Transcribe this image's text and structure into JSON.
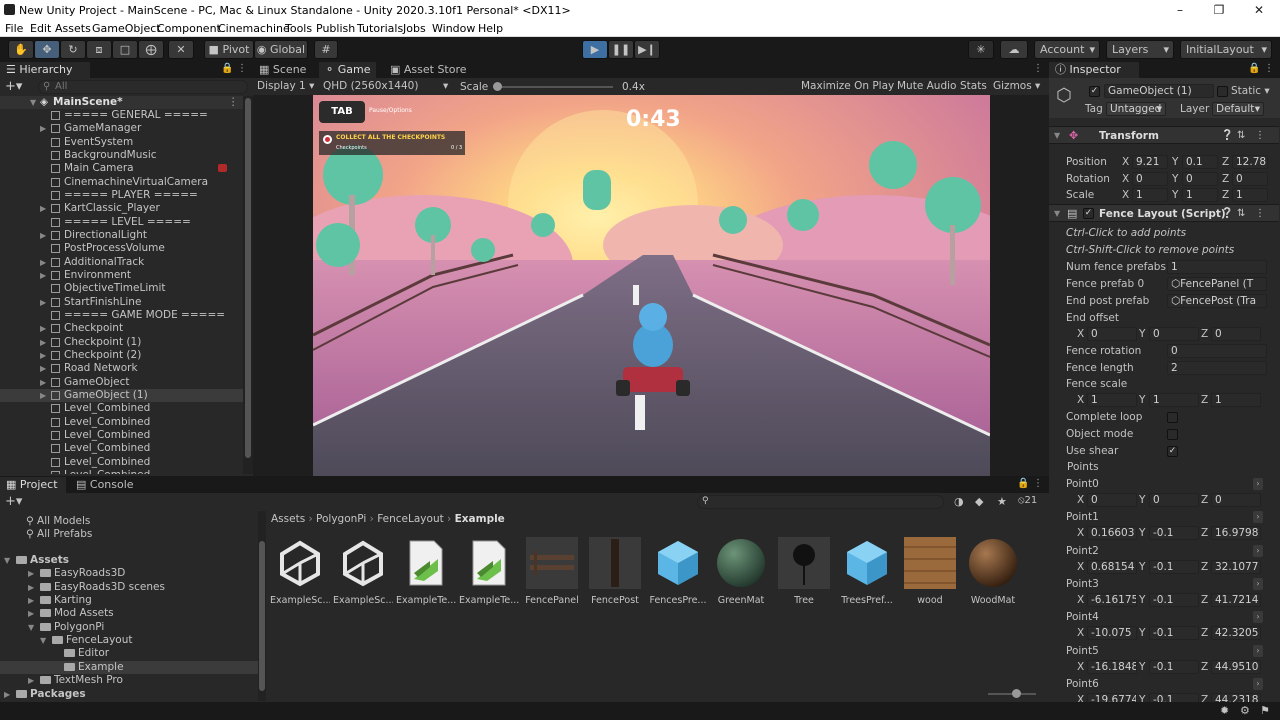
{
  "window": {
    "title": "New Unity Project - MainScene - PC, Mac & Linux Standalone - Unity 2020.3.10f1 Personal* <DX11>"
  },
  "menu": [
    "File",
    "Edit",
    "Assets",
    "GameObject",
    "Component",
    "Cinemachine",
    "Tools",
    "Publish",
    "Tutorials",
    "Jobs",
    "Window",
    "Help"
  ],
  "toolbar": {
    "pivot": "Pivot",
    "global": "Global",
    "account": "Account",
    "layers": "Layers",
    "layout": "InitialLayout"
  },
  "hierarchy": {
    "tab": "Hierarchy",
    "search_placeholder": "All",
    "scene": "MainScene*",
    "items": [
      {
        "label": "===== GENERAL =====",
        "arrow": false
      },
      {
        "label": "GameManager",
        "arrow": true
      },
      {
        "label": "EventSystem",
        "arrow": false
      },
      {
        "label": "BackgroundMusic",
        "arrow": false
      },
      {
        "label": "Main Camera",
        "arrow": false
      },
      {
        "label": "CinemachineVirtualCamera",
        "arrow": false
      },
      {
        "label": "===== PLAYER =====",
        "arrow": false
      },
      {
        "label": "KartClassic_Player",
        "arrow": true
      },
      {
        "label": "===== LEVEL =====",
        "arrow": false
      },
      {
        "label": "DirectionalLight",
        "arrow": true
      },
      {
        "label": "PostProcessVolume",
        "arrow": false
      },
      {
        "label": "AdditionalTrack",
        "arrow": true
      },
      {
        "label": "Environment",
        "arrow": true
      },
      {
        "label": "ObjectiveTimeLimit",
        "arrow": false
      },
      {
        "label": "StartFinishLine",
        "arrow": true
      },
      {
        "label": "===== GAME MODE =====",
        "arrow": false
      },
      {
        "label": "Checkpoint",
        "arrow": true
      },
      {
        "label": "Checkpoint (1)",
        "arrow": true
      },
      {
        "label": "Checkpoint (2)",
        "arrow": true
      },
      {
        "label": "Road Network",
        "arrow": true
      },
      {
        "label": "GameObject",
        "arrow": true
      },
      {
        "label": "GameObject (1)",
        "arrow": true,
        "selected": true
      },
      {
        "label": "Level_Combined",
        "arrow": false
      },
      {
        "label": "Level_Combined",
        "arrow": false
      },
      {
        "label": "Level_Combined",
        "arrow": false
      },
      {
        "label": "Level_Combined",
        "arrow": false
      },
      {
        "label": "Level_Combined",
        "arrow": false
      },
      {
        "label": "Level_Combined",
        "arrow": false
      }
    ]
  },
  "game_view": {
    "tabs": [
      "Scene",
      "Game",
      "Asset Store"
    ],
    "display": "Display 1",
    "resolution": "QHD (2560x1440)",
    "scale_label": "Scale",
    "scale_value": "0.4x",
    "buttons": [
      "Maximize On Play",
      "Mute Audio",
      "Stats",
      "Gizmos"
    ],
    "hud": {
      "tab_key": "TAB",
      "tab_hint": "Pause/Options",
      "objective": "COLLECT ALL THE CHECKPOINTS",
      "objective_sub": "Checkpoints",
      "objective_count": "0 / 3",
      "timer": "0:43"
    }
  },
  "project": {
    "tabs": [
      "Project",
      "Console"
    ],
    "favorites": [
      "All Models",
      "All Prefabs"
    ],
    "tree": [
      {
        "label": "Assets",
        "bold": true
      },
      {
        "label": "EasyRoads3D"
      },
      {
        "label": "EasyRoads3D scenes"
      },
      {
        "label": "Karting"
      },
      {
        "label": "Mod Assets"
      },
      {
        "label": "PolygonPi"
      },
      {
        "label": "FenceLayout"
      },
      {
        "label": "Editor"
      },
      {
        "label": "Example",
        "selected": true
      },
      {
        "label": "TextMesh Pro"
      },
      {
        "label": "Packages",
        "bold": true
      }
    ],
    "breadcrumb": [
      "Assets",
      "PolygonPi",
      "FenceLayout",
      "Example"
    ],
    "hidden_count": "21",
    "assets": [
      {
        "name": "ExampleSc...",
        "kind": "unity"
      },
      {
        "name": "ExampleSc...",
        "kind": "unity"
      },
      {
        "name": "ExampleTe...",
        "kind": "texture"
      },
      {
        "name": "ExampleTe...",
        "kind": "texture"
      },
      {
        "name": "FencePanel",
        "kind": "fencepanel"
      },
      {
        "name": "FencePost",
        "kind": "fencepost"
      },
      {
        "name": "FencesPre...",
        "kind": "prefab"
      },
      {
        "name": "GreenMat",
        "kind": "greenmat"
      },
      {
        "name": "Tree",
        "kind": "tree"
      },
      {
        "name": "TreesPref...",
        "kind": "prefab"
      },
      {
        "name": "wood",
        "kind": "wood"
      },
      {
        "name": "WoodMat",
        "kind": "woodmat"
      }
    ]
  },
  "inspector": {
    "tab": "Inspector",
    "object_name": "GameObject (1)",
    "static_label": "Static",
    "tag_label": "Tag",
    "tag_value": "Untagged",
    "layer_label": "Layer",
    "layer_value": "Default",
    "transform": {
      "title": "Transform",
      "position_label": "Position",
      "rotation_label": "Rotation",
      "scale_label": "Scale",
      "position": [
        "9.21",
        "0.1",
        "12.78"
      ],
      "rotation": [
        "0",
        "0",
        "0"
      ],
      "scale": [
        "1",
        "1",
        "1"
      ]
    },
    "fence": {
      "title": "Fence Layout (Script)",
      "hint1": "Ctrl-Click to add points",
      "hint2": "Ctrl-Shift-Click to remove points",
      "num_label": "Num fence prefabs",
      "num_value": "1",
      "prefab0_label": "Fence prefab 0",
      "prefab0_value": "FencePanel (T",
      "endpost_label": "End post prefab",
      "endpost_value": "FencePost (Tra",
      "endoffset_label": "End offset",
      "endoffset": [
        "0",
        "0",
        "0"
      ],
      "rotation_label": "Fence rotation",
      "rotation_value": "0",
      "length_label": "Fence length",
      "length_value": "2",
      "scale_label": "Fence scale",
      "scale": [
        "1",
        "1",
        "1"
      ],
      "loop_label": "Complete loop",
      "objmode_label": "Object mode",
      "shear_label": "Use shear",
      "points_label": "Points",
      "points": [
        {
          "label": "Point0",
          "x": "0",
          "y": "0",
          "z": "0"
        },
        {
          "label": "Point1",
          "x": "0.16603",
          "y": "-0.1",
          "z": "16.9798"
        },
        {
          "label": "Point2",
          "x": "0.68154",
          "y": "-0.1",
          "z": "32.1077"
        },
        {
          "label": "Point3",
          "x": "-6.16175",
          "y": "-0.1",
          "z": "41.7214"
        },
        {
          "label": "Point4",
          "x": "-10.075",
          "y": "-0.1",
          "z": "42.3205"
        },
        {
          "label": "Point5",
          "x": "-16.1848",
          "y": "-0.1",
          "z": "44.9510"
        },
        {
          "label": "Point6",
          "x": "-19.6774",
          "y": "-0.1",
          "z": "44.2318"
        }
      ]
    }
  },
  "colors": {
    "accent": "#46607c",
    "panel": "#282828",
    "background": "#191919"
  }
}
